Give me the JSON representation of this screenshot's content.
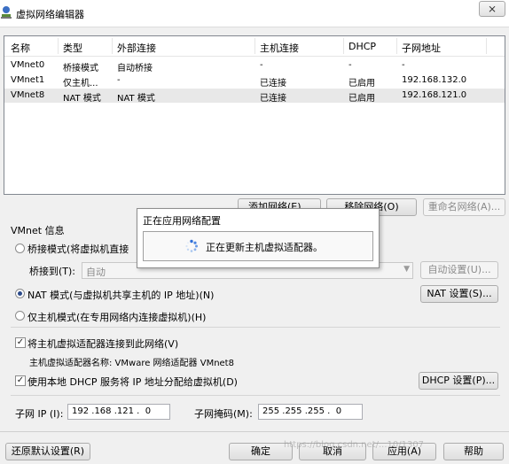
{
  "window": {
    "title": "虚拟网络编辑器",
    "close_glyph": "⨯"
  },
  "table": {
    "columns": [
      "名称",
      "类型",
      "外部连接",
      "主机连接",
      "DHCP",
      "子网地址"
    ],
    "rows": [
      {
        "name": "VMnet0",
        "type": "桥接模式",
        "external": "自动桥接",
        "host": "-",
        "dhcp": "-",
        "subnet": "-"
      },
      {
        "name": "VMnet1",
        "type": "仅主机...",
        "external": "-",
        "host": "已连接",
        "dhcp": "已启用",
        "subnet": "192.168.132.0"
      },
      {
        "name": "VMnet8",
        "type": "NAT 模式",
        "external": "NAT 模式",
        "host": "已连接",
        "dhcp": "已启用",
        "subnet": "192.168.121.0"
      }
    ]
  },
  "buttons": {
    "add_network": "添加网络(E)...",
    "remove_network": "移除网络(O)",
    "rename_network": "重命名网络(A)...",
    "auto_settings": "自动设置(U)...",
    "nat_settings": "NAT 设置(S)...",
    "dhcp_settings": "DHCP 设置(P)...",
    "restore_defaults": "还原默认设置(R)",
    "ok": "确定",
    "cancel": "取消",
    "apply": "应用(A)",
    "help": "帮助"
  },
  "vmnet_info": {
    "heading": "VMnet 信息",
    "bridged_label": "桥接模式(将虚拟机直接",
    "bridged_to_label": "桥接到(T):",
    "bridged_to_value": "自动",
    "nat_label": "NAT 模式(与虚拟机共享主机的 IP 地址)(N)",
    "hostonly_label": "仅主机模式(在专用网络内连接虚拟机)(H)",
    "connect_adapter_label": "将主机虚拟适配器连接到此网络(V)",
    "adapter_name_text": "主机虚拟适配器名称: VMware 网络适配器 VMnet8",
    "use_dhcp_label": "使用本地 DHCP 服务将 IP 地址分配给虚拟机(D)",
    "subnet_ip_label": "子网 IP (I):",
    "subnet_ip_value": "192 .168 .121 .  0",
    "subnet_mask_label": "子网掩码(M):",
    "subnet_mask_value": "255 .255 .255 .  0",
    "selected_mode": "nat",
    "connect_adapter_checked": true,
    "use_dhcp_checked": true
  },
  "progress_dialog": {
    "title": "正在应用网络配置",
    "message": "正在更新主机虚拟适配器。"
  },
  "watermark": "https://blog.csdn.net/...10/1307"
}
